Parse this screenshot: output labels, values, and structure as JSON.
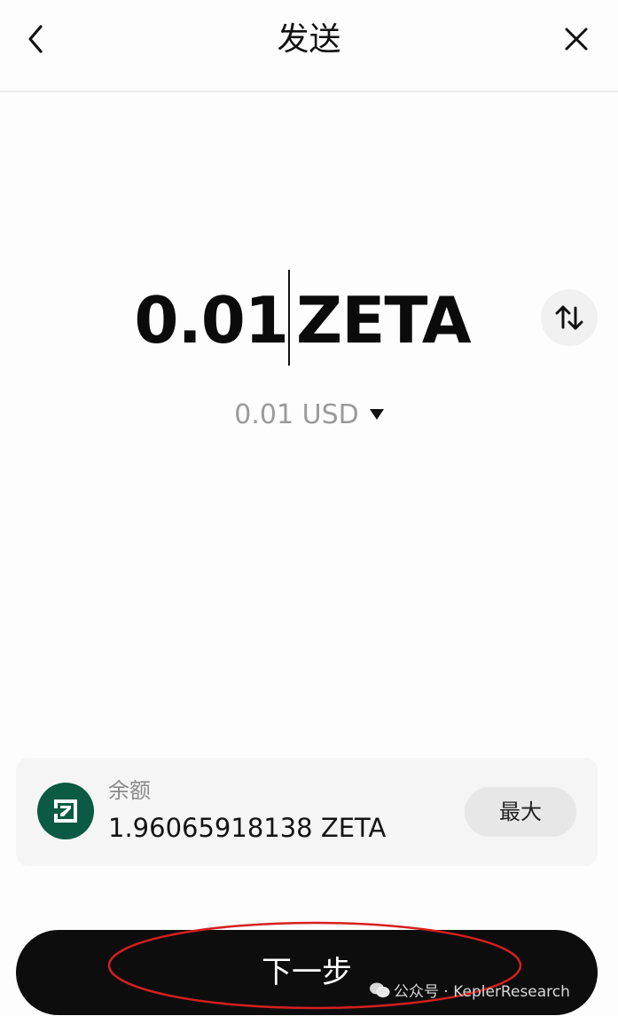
{
  "header": {
    "title": "发送",
    "back_icon": "chevron-left-icon",
    "close_icon": "close-icon"
  },
  "amount": {
    "value": "0.01",
    "unit": "ZETA",
    "swap_icon": "swap-arrows-icon"
  },
  "fiat": {
    "value": "0.01 USD",
    "caret_icon": "caret-down-icon"
  },
  "balance": {
    "label": "余额",
    "value": "1.96065918138 ZETA",
    "token_icon": "zeta-token-icon",
    "token_color": "#0b5a43",
    "max_label": "最大"
  },
  "next_button": {
    "label": "下一步"
  },
  "annotation": {
    "color": "#d61f1f"
  },
  "watermark": {
    "text": "公众号 · KeplerResearch",
    "icon": "wechat-icon"
  },
  "colors": {
    "primary_button": "#0d0d0d",
    "muted_text": "#9a9a9a",
    "card_bg": "#f5f5f5"
  }
}
